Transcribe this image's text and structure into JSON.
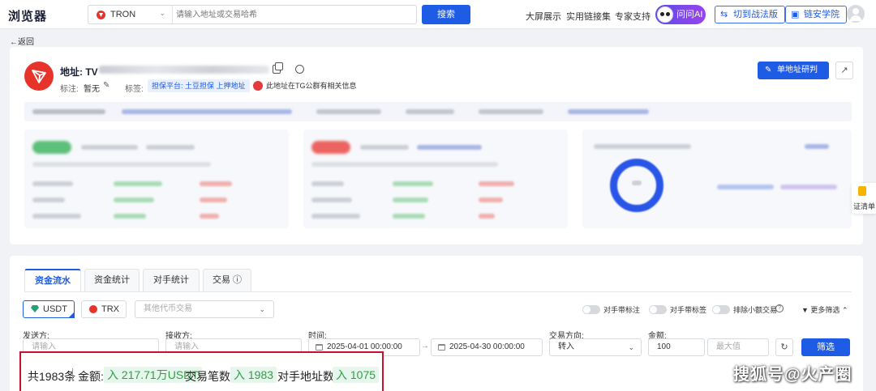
{
  "header": {
    "logo": "浏览器",
    "chain": "TRON",
    "search_placeholder": "请输入地址或交易哈希",
    "search_button": "搜索",
    "nav": [
      "大屏展示",
      "实用链接集",
      "专家支持"
    ],
    "ai_button": "问问AI",
    "switch_button": "切到战法版",
    "academy_button": "链安学院"
  },
  "back": "返回",
  "address": {
    "label": "地址:",
    "prefix": "TV",
    "remark_label": "标注:",
    "remark_value": "暂无",
    "tags_label": "标签:",
    "tag": "担保平台: 土豆担保 上押地址",
    "tg_note": "此地址在TG公群有相关信息",
    "research_button": "单地址研判"
  },
  "side_widget": "证清单",
  "tabs": [
    "资金流水",
    "资金统计",
    "对手统计",
    "交易"
  ],
  "coins": [
    "USDT",
    "TRX"
  ],
  "other_coin_placeholder": "其他代币交易",
  "toggles": [
    "对手带标注",
    "对手带标签",
    "排除小额交易"
  ],
  "more_filter": "更多筛选",
  "filters": {
    "sender_label": "发送方:",
    "sender_placeholder": "请输入",
    "receiver_label": "接收方:",
    "receiver_placeholder": "请输入",
    "time_label": "时间:",
    "time_start": "2025-04-01 00:00:00",
    "time_end": "2025-04-30 00:00:00",
    "direction_label": "交易方向:",
    "direction_value": "转入",
    "amount_label": "金额:",
    "amount_min": "100",
    "amount_max_placeholder": "最大值",
    "filter_button": "筛选"
  },
  "summary": {
    "total": "共1983条",
    "amount_label": "金额:",
    "amount_value": "入 217.71万USDT",
    "count_label": "交易笔数:",
    "count_value": "入 1983",
    "counterparty_label": "对手地址数:",
    "counterparty_value": "入 1075"
  },
  "watermark": "搜狐号@火产圈",
  "colors": {
    "accent": "#1f5ce6",
    "tron": "#e6342a",
    "inflow": "#2f9e44",
    "highlight": "#c8102e"
  }
}
